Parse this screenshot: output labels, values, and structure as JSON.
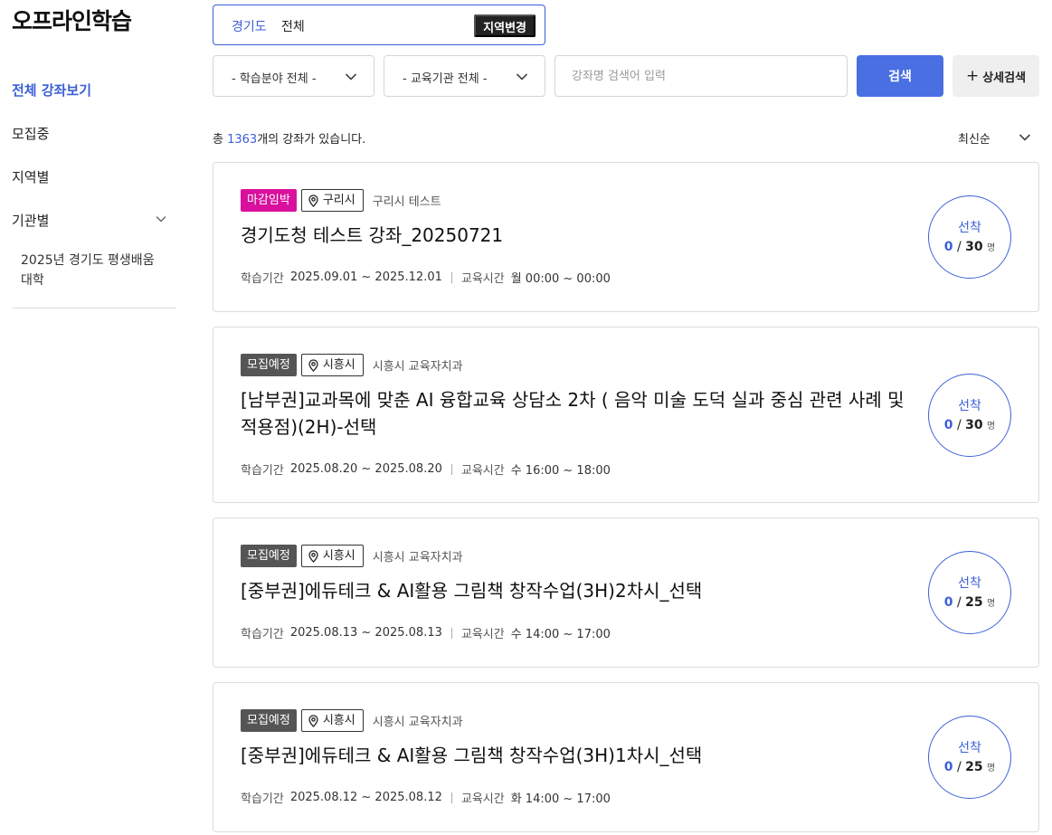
{
  "sidebar": {
    "title": "오프라인학습",
    "items": [
      {
        "label": "전체 강좌보기"
      },
      {
        "label": "모집중"
      },
      {
        "label": "지역별"
      },
      {
        "label": "기관별"
      }
    ],
    "sub_item": "2025년 경기도 평생배움대학"
  },
  "region": {
    "province": "경기도",
    "city": "전체",
    "change_label": "지역변경"
  },
  "filters": {
    "field_select": "- 학습분야 전체 -",
    "institution_select": "- 교육기관 전체 -",
    "search_placeholder": "강좌명 검색어 입력",
    "search_label": "검색",
    "advanced_plus": "+",
    "advanced_label": "상세검색"
  },
  "summary": {
    "prefix": "총",
    "count": "1363",
    "suffix": "개의 강좌가 있습니다.",
    "sort_label": "최신순"
  },
  "labels": {
    "period": "학습기간",
    "time": "교육시간"
  },
  "courses": [
    {
      "status": "마감임박",
      "location": "구리시",
      "institution": "구리시 테스트",
      "title": "경기도청 테스트 강좌_20250721",
      "period": "2025.09.01 ~ 2025.12.01",
      "schedule": "월 00:00 ~ 00:00",
      "selection": "선착",
      "current": "0",
      "capacity_sep": "/",
      "capacity": "30",
      "unit": "명"
    },
    {
      "status": "모집예정",
      "location": "시흥시",
      "institution": "시흥시 교육자치과",
      "title": "[남부권]교과목에 맞춘 AI 융합교육 상담소 2차 ( 음악 미술 도덕 실과 중심 관련 사례 및 적용점)(2H)-선택",
      "period": "2025.08.20 ~ 2025.08.20",
      "schedule": "수 16:00 ~ 18:00",
      "selection": "선착",
      "current": "0",
      "capacity_sep": "/",
      "capacity": "30",
      "unit": "명"
    },
    {
      "status": "모집예정",
      "location": "시흥시",
      "institution": "시흥시 교육자치과",
      "title": "[중부권]에듀테크 & AI활용 그림책 창작수업(3H)2차시_선택",
      "period": "2025.08.13 ~ 2025.08.13",
      "schedule": "수 14:00 ~ 17:00",
      "selection": "선착",
      "current": "0",
      "capacity_sep": "/",
      "capacity": "25",
      "unit": "명"
    },
    {
      "status": "모집예정",
      "location": "시흥시",
      "institution": "시흥시 교육자치과",
      "title": "[중부권]에듀테크 & AI활용 그림책 창작수업(3H)1차시_선택",
      "period": "2025.08.12 ~ 2025.08.12",
      "schedule": "화 14:00 ~ 17:00",
      "selection": "선착",
      "current": "0",
      "capacity_sep": "/",
      "capacity": "25",
      "unit": "명"
    }
  ],
  "colors": {
    "accent": "#3b5fd6",
    "search_button": "#4a6fe3",
    "closing_badge": "#d90f9d",
    "planned_badge": "#555555"
  },
  "icons": {
    "location": "map-pin-icon",
    "dropdown": "chevron-down-icon"
  }
}
